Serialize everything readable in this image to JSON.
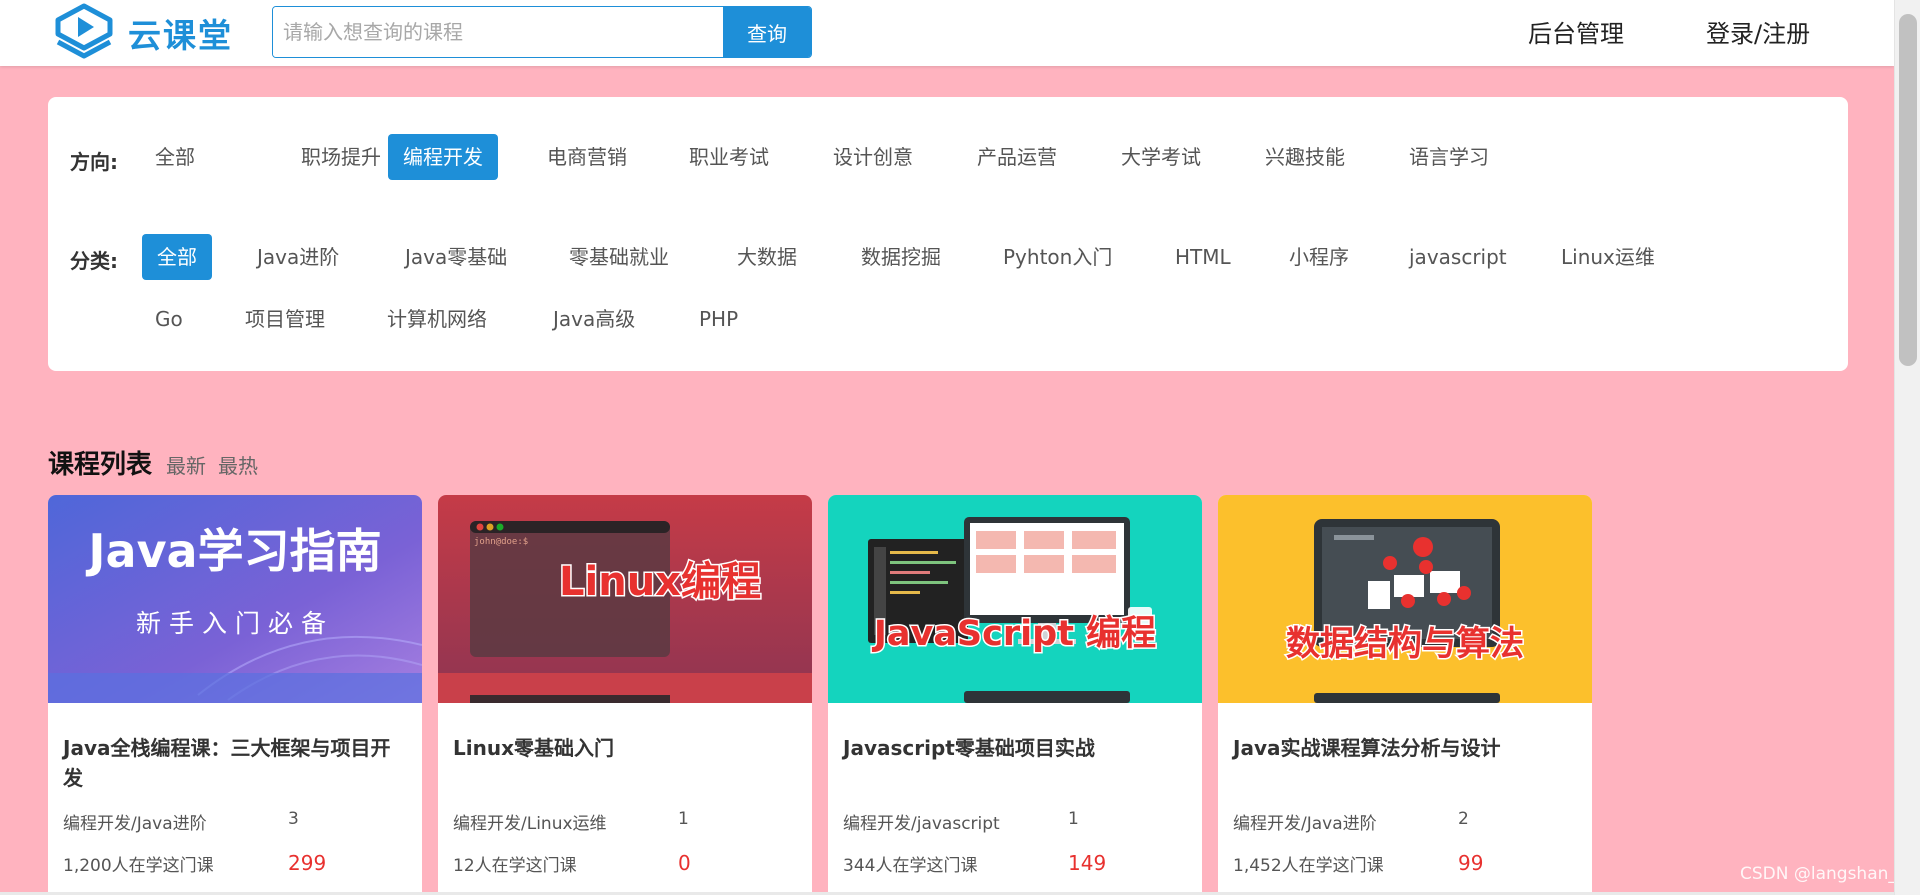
{
  "header": {
    "logo_text": "云课堂",
    "search_placeholder": "请输入想查询的课程",
    "search_button": "查询",
    "admin_link": "后台管理",
    "login_link": "登录/注册"
  },
  "filters": {
    "direction_label": "方向:",
    "directions": [
      "全部",
      "职场提升",
      "编程开发",
      "电商营销",
      "职业考试",
      "设计创意",
      "产品运营",
      "大学考试",
      "兴趣技能",
      "语言学习"
    ],
    "direction_active": "编程开发",
    "category_label": "分类:",
    "categories": [
      "全部",
      "Java进阶",
      "Java零基础",
      "零基础就业",
      "大数据",
      "数据挖掘",
      "Pyhton入门",
      "HTML",
      "小程序",
      "javascript",
      "Linux运维",
      "Go",
      "项目管理",
      "计算机网络",
      "Java高级",
      "PHP"
    ],
    "category_active": "全部"
  },
  "course_list": {
    "title": "课程列表",
    "sort_new": "最新",
    "sort_hot": "最热",
    "courses": [
      {
        "image_text_1": "Java学习指南",
        "image_text_2": "新手入门必备",
        "title": "Java全栈编程课：三大框架与项目开发",
        "category": "编程开发/Java进阶",
        "count": "3",
        "learners": "1,200人在学这门课",
        "price": "299"
      },
      {
        "image_text_1": "Linux编程",
        "image_text_2": "john@doe:$",
        "title": "Linux零基础入门",
        "category": "编程开发/Linux运维",
        "count": "1",
        "learners": "12人在学这门课",
        "price": "0"
      },
      {
        "image_text_1": "JavaScript 编程",
        "title": "Javascript零基础项目实战",
        "category": "编程开发/javascript",
        "count": "1",
        "learners": "344人在学这门课",
        "price": "149"
      },
      {
        "image_text_1": "数据结构与算法",
        "title": "Java实战课程算法分析与设计",
        "category": "编程开发/Java进阶",
        "count": "2",
        "learners": "1,452人在学这门课",
        "price": "99"
      }
    ]
  },
  "watermark": "CSDN @langshan_",
  "colors": {
    "accent": "#1e8fd8",
    "background": "#ffb3bf",
    "price": "#e8312f"
  }
}
